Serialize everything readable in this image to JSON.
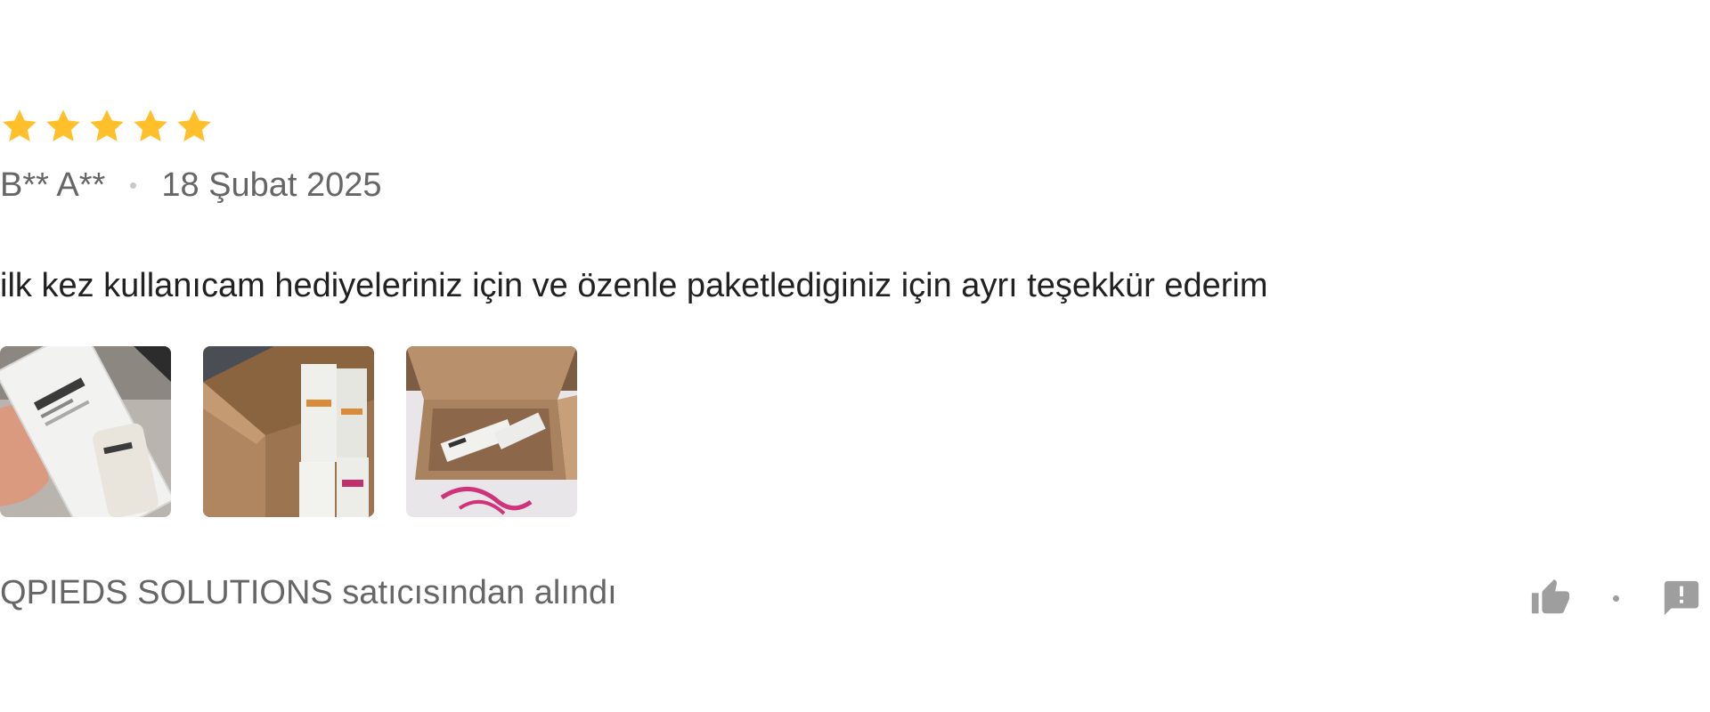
{
  "review": {
    "rating": 5,
    "rating_max": 5,
    "author": "B** A**",
    "date": "18 Şubat 2025",
    "text": "ilk kez kullanıcam hediyeleriniz için ve özenle paketlediginiz için ayrı teşekkür ederim",
    "photo_count": 3,
    "seller_text": "QPIEDS SOLUTIONS satıcısından alındı"
  },
  "icons": {
    "star": "star-icon",
    "like": "thumbs-up-icon",
    "report": "report-icon"
  },
  "colors": {
    "star": "#FFC02B",
    "meta_text": "#666666",
    "body_text": "#212121",
    "icon": "#9E9E9E"
  }
}
